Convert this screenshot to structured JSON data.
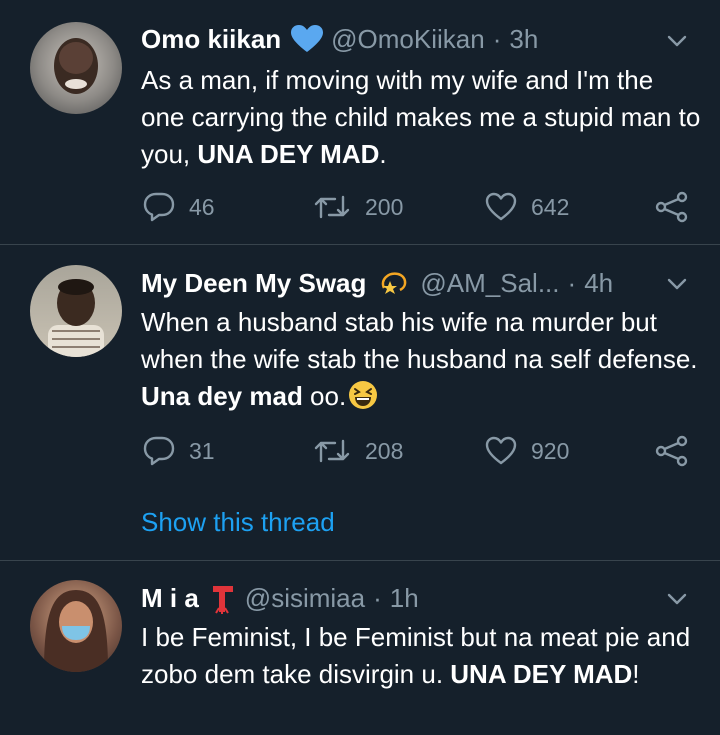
{
  "tweets": [
    {
      "name": "Omo kiikan",
      "handle": "@OmoKiikan",
      "separator": "·",
      "time": "3h",
      "body_plain": "As a man, if moving with my wife and I'm the one carrying the child makes me a stupid man to you, ",
      "body_bold": "UNA DEY MAD",
      "body_tail": ".",
      "replies": "46",
      "retweets": "200",
      "likes": "642",
      "badge_icon": "blue-heart-icon"
    },
    {
      "name": "My Deen My Swag",
      "handle": "@AM_Sal...",
      "separator": "·",
      "time": "4h",
      "body_plain": "When a husband stab his wife na murder but when the wife stab the husband na self defense. ",
      "body_bold": "Una dey mad",
      "body_tail": " oo.",
      "replies": "31",
      "retweets": "208",
      "likes": "920",
      "badge_icon": "dizzy-star-icon",
      "emoji_icon": "grinning-squinting-face-icon",
      "show_thread": "Show this thread"
    },
    {
      "name": "M i a",
      "handle": "@sisimiaa",
      "separator": "·",
      "time": "1h",
      "body_plain": "I be Feminist, I be Feminist but na meat pie and zobo dem take disvirgin u. ",
      "body_bold": "UNA DEY MAD",
      "body_tail": "!",
      "badge_icon": "red-scarf-icon"
    }
  ],
  "colors": {
    "background": "#15202b",
    "divider": "#38444d",
    "secondary_text": "#8899a6",
    "link": "#1da1f2",
    "heart": "#5aa8f0",
    "emoji": "#f7c843",
    "scarf": "#e0343a"
  }
}
